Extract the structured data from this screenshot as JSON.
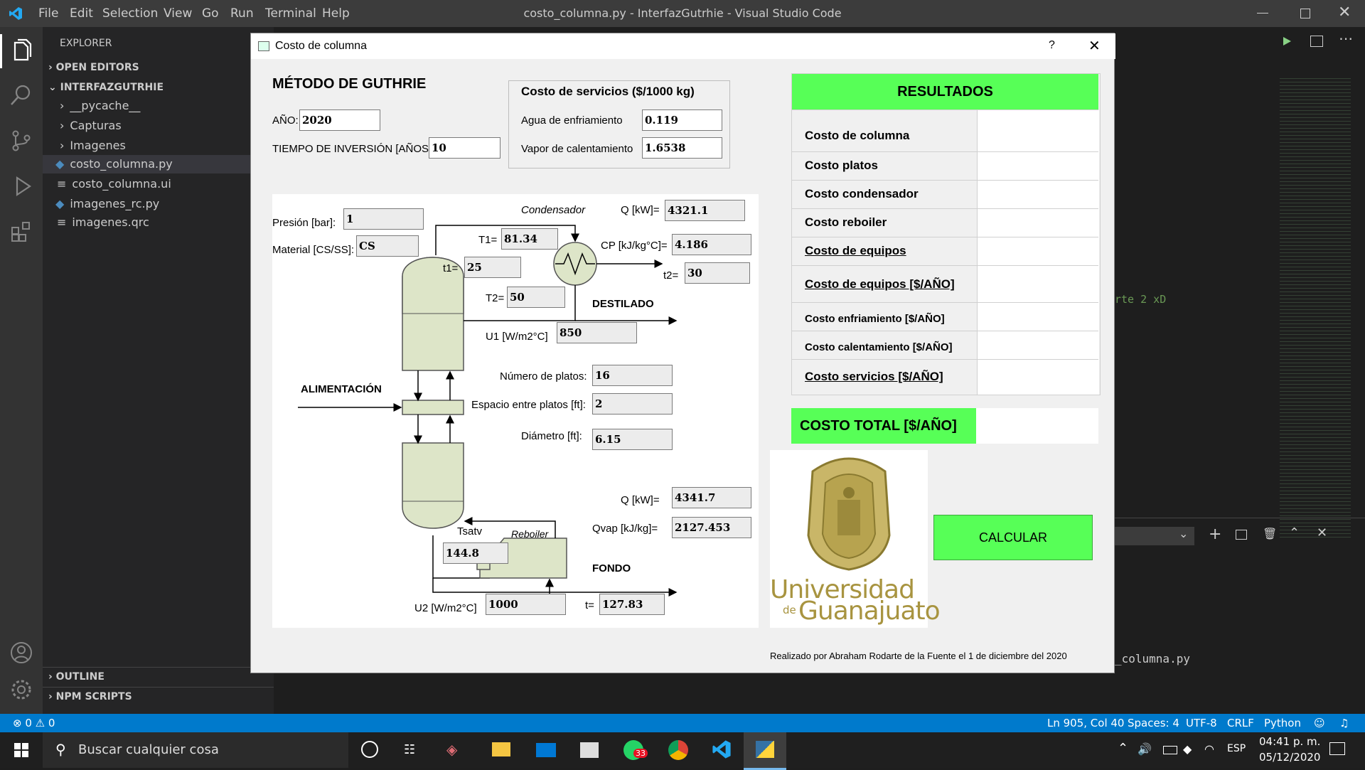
{
  "window": {
    "menu": [
      "File",
      "Edit",
      "Selection",
      "View",
      "Go",
      "Run",
      "Terminal",
      "Help"
    ],
    "title": "costo_columna.py - InterfazGutrhie - Visual Studio Code"
  },
  "explorer": {
    "header": "EXPLORER",
    "open_editors": "OPEN EDITORS",
    "project": "INTERFAZGUTRHIE",
    "items": [
      "__pycache__",
      "Capturas",
      "Imagenes",
      "costo_columna.py",
      "costo_columna.ui",
      "imagenes_rc.py",
      "imagenes.qrc"
    ],
    "outline": "OUTLINE",
    "npm": "NPM SCRIPTS"
  },
  "editor": {
    "fragment1": "rte 2 xD",
    "fragment2": "_columna.py"
  },
  "statusbar": {
    "errors": "0",
    "warnings": "0",
    "position": "Ln 905, Col 40",
    "spaces": "Spaces: 4",
    "encoding": "UTF-8",
    "eol": "CRLF",
    "language": "Python"
  },
  "taskbar": {
    "search_placeholder": "Buscar cualquier cosa",
    "whatsapp_badge": "33",
    "lang": "ESP",
    "time": "04:41 p. m.",
    "date": "05/12/2020"
  },
  "dialog": {
    "title": "Costo de columna",
    "help": "?",
    "heading": "MÉTODO DE GUTHRIE",
    "anio_label": "AÑO:",
    "anio": "2020",
    "tiempo_label": "TIEMPO DE INVERSIÓN [AÑOS]:",
    "tiempo": "10",
    "servicios_title": "Costo de servicios ($/1000 kg)",
    "agua_label": "Agua de enfriamiento",
    "agua": "0.119",
    "vapor_label": "Vapor de calentamiento",
    "vapor": "1.6538",
    "diagram": {
      "presion_label": "Presión [bar]:",
      "presion": "1",
      "material_label": "Material [CS/SS]:",
      "material": "CS",
      "condensador": "Condensador",
      "q1_label": "Q [kW]=",
      "q1": "4321.1",
      "t1_label": "T1=",
      "t1": "81.34",
      "cp_label": "CP [kJ/kg°C]=",
      "cp": "4.186",
      "tt1_label": "t1=",
      "tt1": "25",
      "t2s_label": "t2=",
      "t2s": "30",
      "t2_label": "T2=",
      "t2": "50",
      "destilado": "DESTILADO",
      "u1_label": "U1 [W/m2°C]",
      "u1": "850",
      "alimentacion": "ALIMENTACIÓN",
      "platos_label": "Número de platos:",
      "platos": "16",
      "espacio_label": "Espacio entre platos [ft]:",
      "espacio": "2",
      "diametro_label": "Diámetro [ft]:",
      "diametro": "6.15",
      "q2_label": "Q [kW]=",
      "q2": "4341.7",
      "tsatv_label": "Tsatv",
      "tsatv": "144.8",
      "reboiler": "Reboiler",
      "qvap_label": "Qvap [kJ/kg]=",
      "qvap": "2127.453",
      "fondo": "FONDO",
      "u2_label": "U2 [W/m2°C]",
      "u2": "1000",
      "t_label": "t=",
      "t": "127.83"
    },
    "resultados": {
      "header": "RESULTADOS",
      "rows": [
        "Costo de columna",
        "Costo platos",
        "Costo condensador",
        "Costo reboiler",
        "Costo de equipos",
        "Costo de equipos [$/AÑO]",
        "Costo enfriamiento [$/AÑO]",
        "Costo calentamiento [$/AÑO]",
        "Costo servicios [$/AÑO]"
      ],
      "total_label": "COSTO TOTAL [$/AÑO]"
    },
    "logo": {
      "line1": "Universidad",
      "de": "de",
      "line2": "Guanajuato"
    },
    "calcular": "CALCULAR",
    "footer": "Realizado por Abraham Rodarte de la Fuente el 1 de diciembre del 2020",
    "colors": {
      "green": "#57ff57",
      "vessel": "#dde5c8",
      "logo_gold": "#a89440"
    }
  }
}
